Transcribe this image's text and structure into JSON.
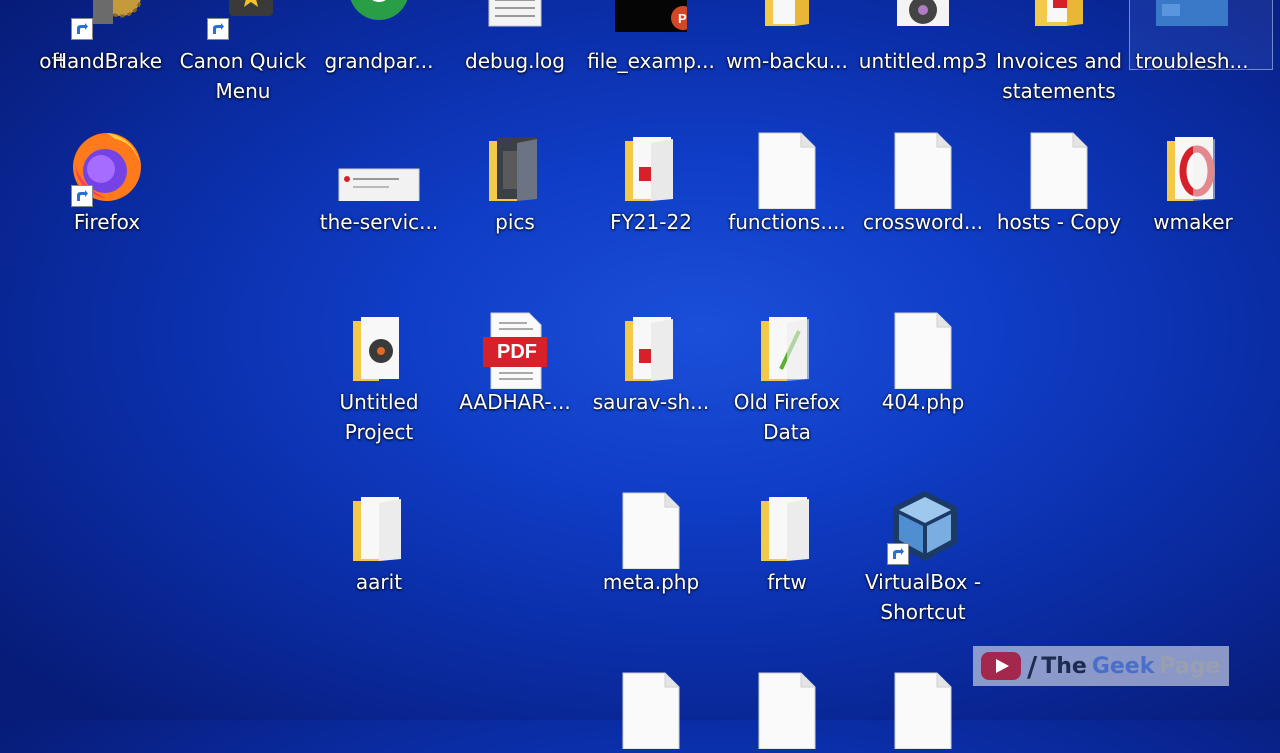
{
  "desktop": {
    "icons": {
      "partial_left": "oft",
      "handbrake": "HandBrake",
      "canon": "Canon Quick Menu",
      "grandpar": "grandpar...",
      "debuglog": "debug.log",
      "file_examp": "file_examp...",
      "wm_backup": "wm-backu...",
      "untitled_mp3": "untitled.mp3",
      "invoices": "Invoices and statements",
      "troublesh": "troublesh...",
      "firefox": "Firefox",
      "the_servic": "the-servic...",
      "pics": "pics",
      "fy21": "FY21-22",
      "functions": "functions....",
      "crossword": "crossword...",
      "hosts_copy": "hosts - Copy",
      "wmaker": "wmaker",
      "untitled_project": "Untitled Project",
      "aadhar": "AADHAR-...",
      "saurav": "saurav-sh...",
      "old_firefox": "Old Firefox Data",
      "php404": "404.php",
      "aarit": "aarit",
      "meta_php": "meta.php",
      "frtw": "frtw",
      "virtualbox": "VirtualBox - Shortcut"
    },
    "pdf_badge": "PDF"
  },
  "watermark": {
    "part1": "The",
    "part2": "Geek",
    "part3": "Page",
    "slash": "/"
  },
  "colors": {
    "folder": "#f3c94a",
    "pdf_red": "#d6202a",
    "accent": "#4a6fc9"
  }
}
